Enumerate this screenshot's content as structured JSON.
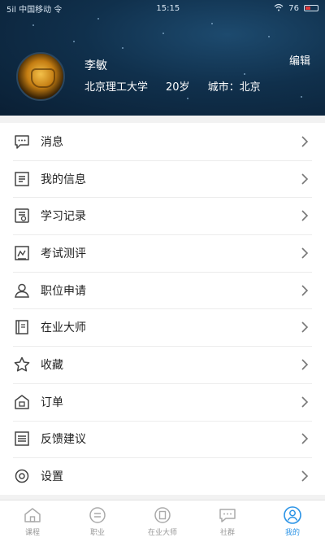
{
  "status_bar": {
    "carrier": "5il 中国移动 令",
    "time": "15:15",
    "signal": "76",
    "battery_color": "#e03a3a"
  },
  "profile": {
    "name": "李敏",
    "school": "北京理工大学",
    "age": "20岁",
    "hometown": "城市：北京",
    "edit_label": "编辑"
  },
  "menu": [
    {
      "label": "消息",
      "icon": "message-icon"
    },
    {
      "label": "我的信息",
      "icon": "profile-card-icon"
    },
    {
      "label": "学习记录",
      "icon": "study-record-icon"
    },
    {
      "label": "考试测评",
      "icon": "exam-icon"
    },
    {
      "label": "职位申请",
      "icon": "person-icon"
    },
    {
      "label": "在业大师",
      "icon": "book-icon"
    },
    {
      "label": "收藏",
      "icon": "star-icon"
    },
    {
      "label": "订单",
      "icon": "order-icon"
    },
    {
      "label": "反馈建议",
      "icon": "feedback-icon"
    },
    {
      "label": "设置",
      "icon": "settings-icon"
    }
  ],
  "tabs": [
    {
      "label": "课程",
      "icon": "home-icon"
    },
    {
      "label": "职业",
      "icon": "career-icon"
    },
    {
      "label": "在业大师",
      "icon": "master-icon"
    },
    {
      "label": "社群",
      "icon": "community-icon"
    },
    {
      "label": "我的",
      "icon": "me-icon",
      "active": true
    }
  ],
  "colors": {
    "accent": "#2a93e6",
    "header_bg": "#10304c"
  }
}
